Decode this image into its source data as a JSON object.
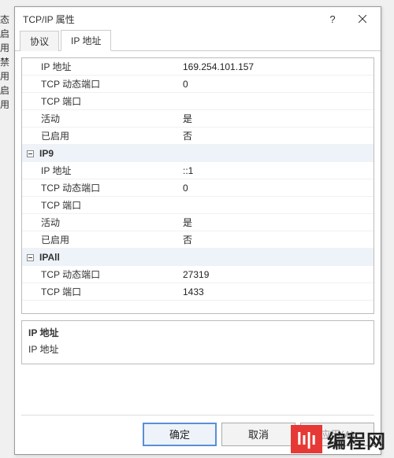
{
  "bg_sidebar": [
    "态",
    "启用",
    "禁用",
    "启用"
  ],
  "dialog": {
    "title": "TCP/IP 属性",
    "help_symbol": "?",
    "tabs": {
      "protocol": "协议",
      "ipaddress": "IP 地址"
    },
    "description": {
      "title": "IP 地址",
      "body": "IP 地址"
    },
    "buttons": {
      "ok": "确定",
      "cancel": "取消",
      "apply": "应用(A)"
    }
  },
  "grid": {
    "groups": [
      {
        "name_hidden": true,
        "name": "",
        "rows": [
          {
            "label": "IP 地址",
            "value": "169.254.101.157"
          },
          {
            "label": "TCP 动态端口",
            "value": "0"
          },
          {
            "label": "TCP 端口",
            "value": ""
          },
          {
            "label": "活动",
            "value": "是"
          },
          {
            "label": "已启用",
            "value": "否"
          }
        ]
      },
      {
        "name_hidden": false,
        "name": "IP9",
        "rows": [
          {
            "label": "IP 地址",
            "value": "::1"
          },
          {
            "label": "TCP 动态端口",
            "value": "0"
          },
          {
            "label": "TCP 端口",
            "value": ""
          },
          {
            "label": "活动",
            "value": "是"
          },
          {
            "label": "已启用",
            "value": "否"
          }
        ]
      },
      {
        "name_hidden": false,
        "name": "IPAll",
        "rows": [
          {
            "label": "TCP 动态端口",
            "value": "27319"
          },
          {
            "label": "TCP 端口",
            "value": "1433"
          }
        ]
      }
    ]
  },
  "watermark": "编程网"
}
